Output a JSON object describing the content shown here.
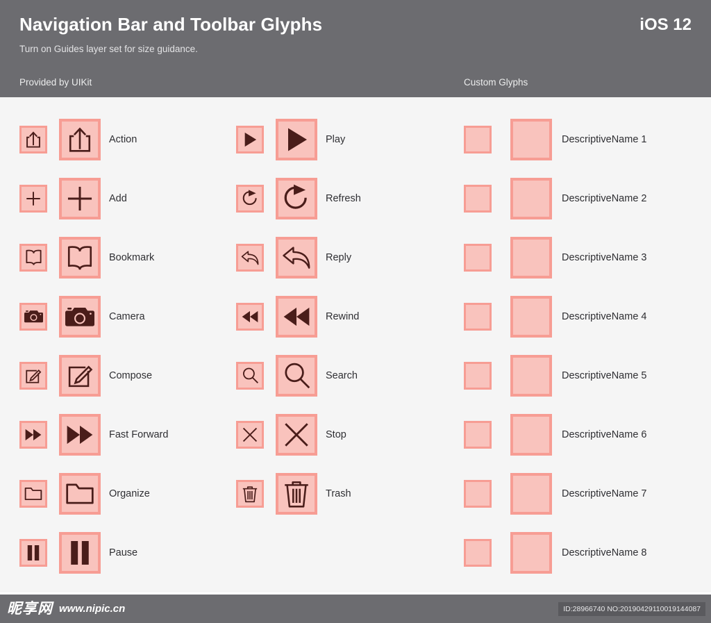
{
  "header": {
    "title": "Navigation Bar and Toolbar Glyphs",
    "os_version": "iOS 12",
    "subtitle": "Turn on Guides layer set for size guidance.",
    "section_uikit": "Provided by UIKit",
    "section_custom": "Custom Glyphs"
  },
  "colors": {
    "header_background": "#6c6c70",
    "page_background": "#f5f5f5",
    "tile_border": "#f79d94",
    "tile_fill": "#f9c3bd",
    "glyph_stroke": "#4a1d1a",
    "label_text": "#2f2f33"
  },
  "columns": {
    "uikit_left": [
      {
        "label": "Action",
        "icon": "action-icon"
      },
      {
        "label": "Add",
        "icon": "add-icon"
      },
      {
        "label": "Bookmark",
        "icon": "bookmark-icon"
      },
      {
        "label": "Camera",
        "icon": "camera-icon"
      },
      {
        "label": "Compose",
        "icon": "compose-icon"
      },
      {
        "label": "Fast Forward",
        "icon": "fast-forward-icon"
      },
      {
        "label": "Organize",
        "icon": "organize-icon"
      },
      {
        "label": "Pause",
        "icon": "pause-icon"
      }
    ],
    "uikit_right": [
      {
        "label": "Play",
        "icon": "play-icon"
      },
      {
        "label": "Refresh",
        "icon": "refresh-icon"
      },
      {
        "label": "Reply",
        "icon": "reply-icon"
      },
      {
        "label": "Rewind",
        "icon": "rewind-icon"
      },
      {
        "label": "Search",
        "icon": "search-icon"
      },
      {
        "label": "Stop",
        "icon": "stop-icon"
      },
      {
        "label": "Trash",
        "icon": "trash-icon"
      }
    ],
    "custom": [
      {
        "label": "DescriptiveName 1",
        "icon": "empty-glyph-placeholder"
      },
      {
        "label": "DescriptiveName 2",
        "icon": "empty-glyph-placeholder"
      },
      {
        "label": "DescriptiveName 3",
        "icon": "empty-glyph-placeholder"
      },
      {
        "label": "DescriptiveName 4",
        "icon": "empty-glyph-placeholder"
      },
      {
        "label": "DescriptiveName 5",
        "icon": "empty-glyph-placeholder"
      },
      {
        "label": "DescriptiveName 6",
        "icon": "empty-glyph-placeholder"
      },
      {
        "label": "DescriptiveName 7",
        "icon": "empty-glyph-placeholder"
      },
      {
        "label": "DescriptiveName 8",
        "icon": "empty-glyph-placeholder"
      }
    ]
  },
  "footer": {
    "logo_text": "昵享网",
    "url": "www.nipic.cn",
    "id_text": "ID:28966740 NO:20190429110019144087"
  }
}
